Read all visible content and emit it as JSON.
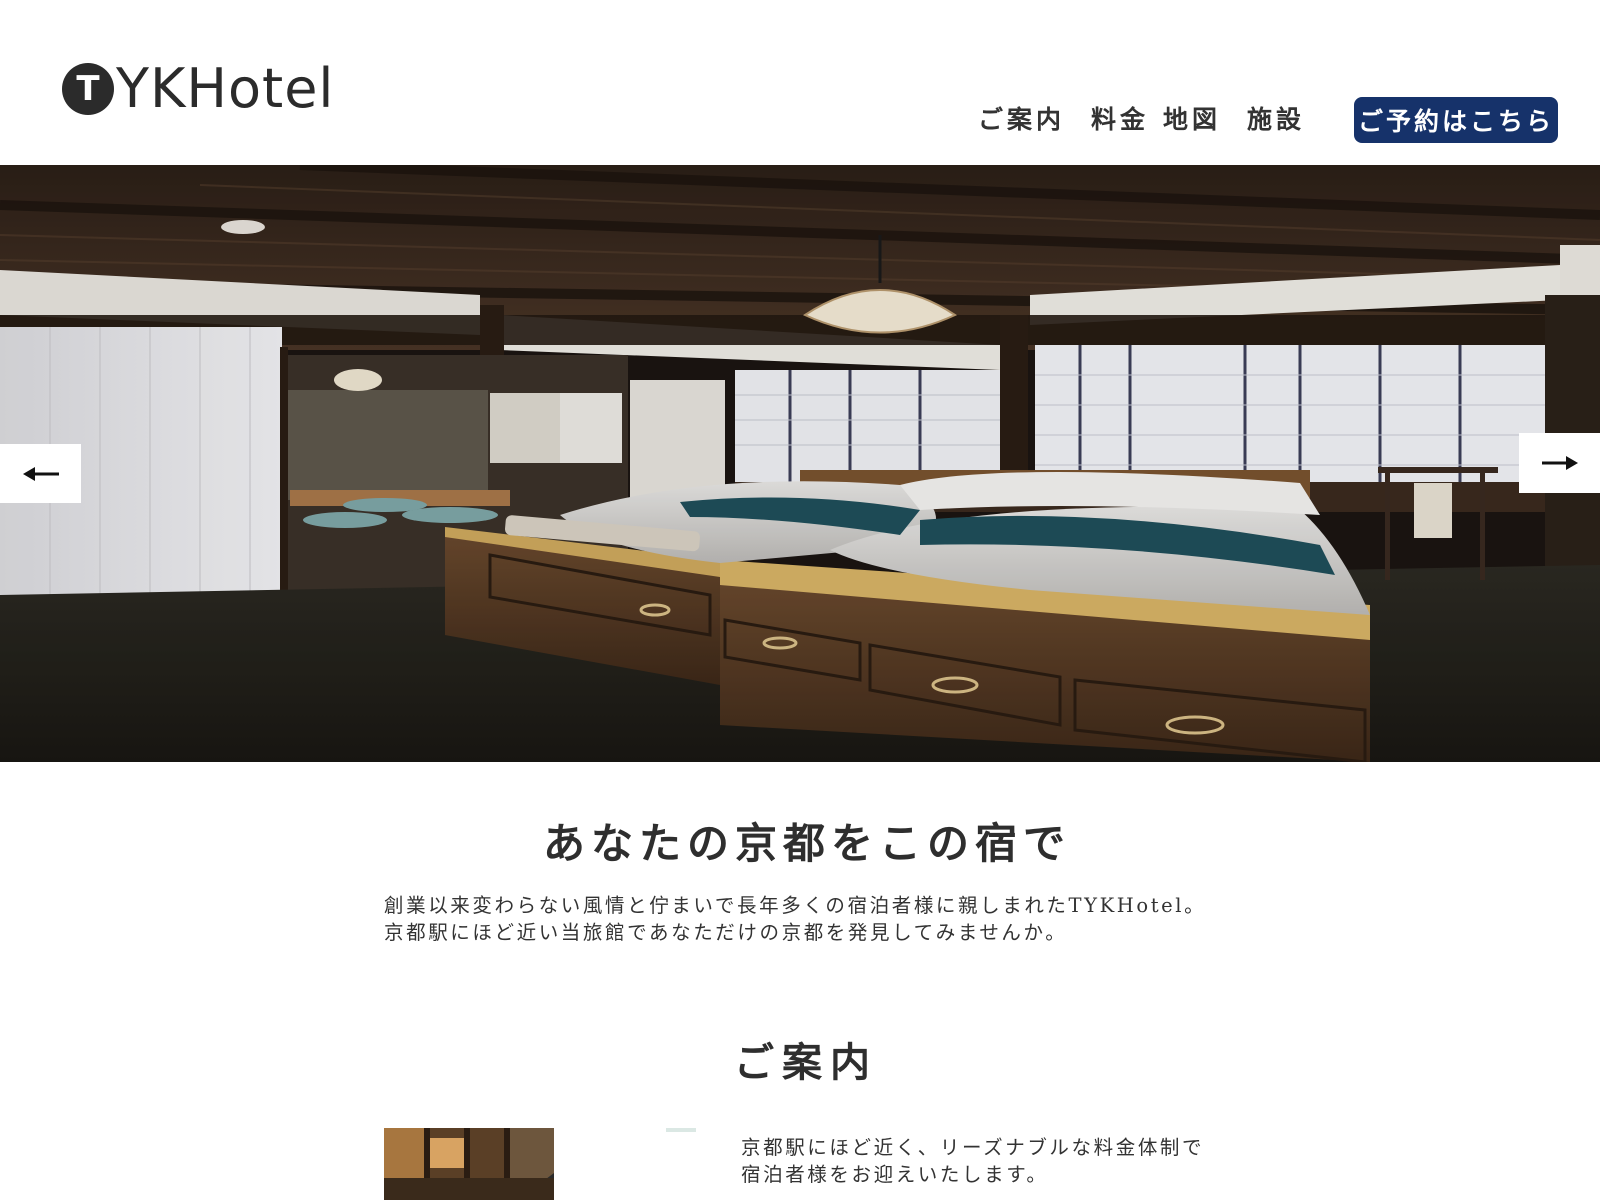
{
  "header": {
    "logo_mark": "T",
    "logo_text": "YKHotel",
    "nav": [
      "ご案内",
      "料金",
      "地図",
      "施設"
    ],
    "reserve_label": "ご予約はこちら",
    "accent_color": "#16326a"
  },
  "hero": {
    "prev_icon": "arrow-left-icon",
    "next_icon": "arrow-right-icon"
  },
  "intro": {
    "title": "あなたの京都をこの宿で",
    "lines": [
      "創業以来変わらない風情と佇まいで長年多くの宿泊者様に親しまれたTYKHotel。",
      "京都駅にほど近い当旅館であなただけの京都を発見してみませんか。"
    ]
  },
  "guide": {
    "title": "ご案内",
    "lines": [
      "京都駅にほど近く、リーズナブルな料金体制で",
      "宿泊者様をお迎えいたします。"
    ]
  }
}
